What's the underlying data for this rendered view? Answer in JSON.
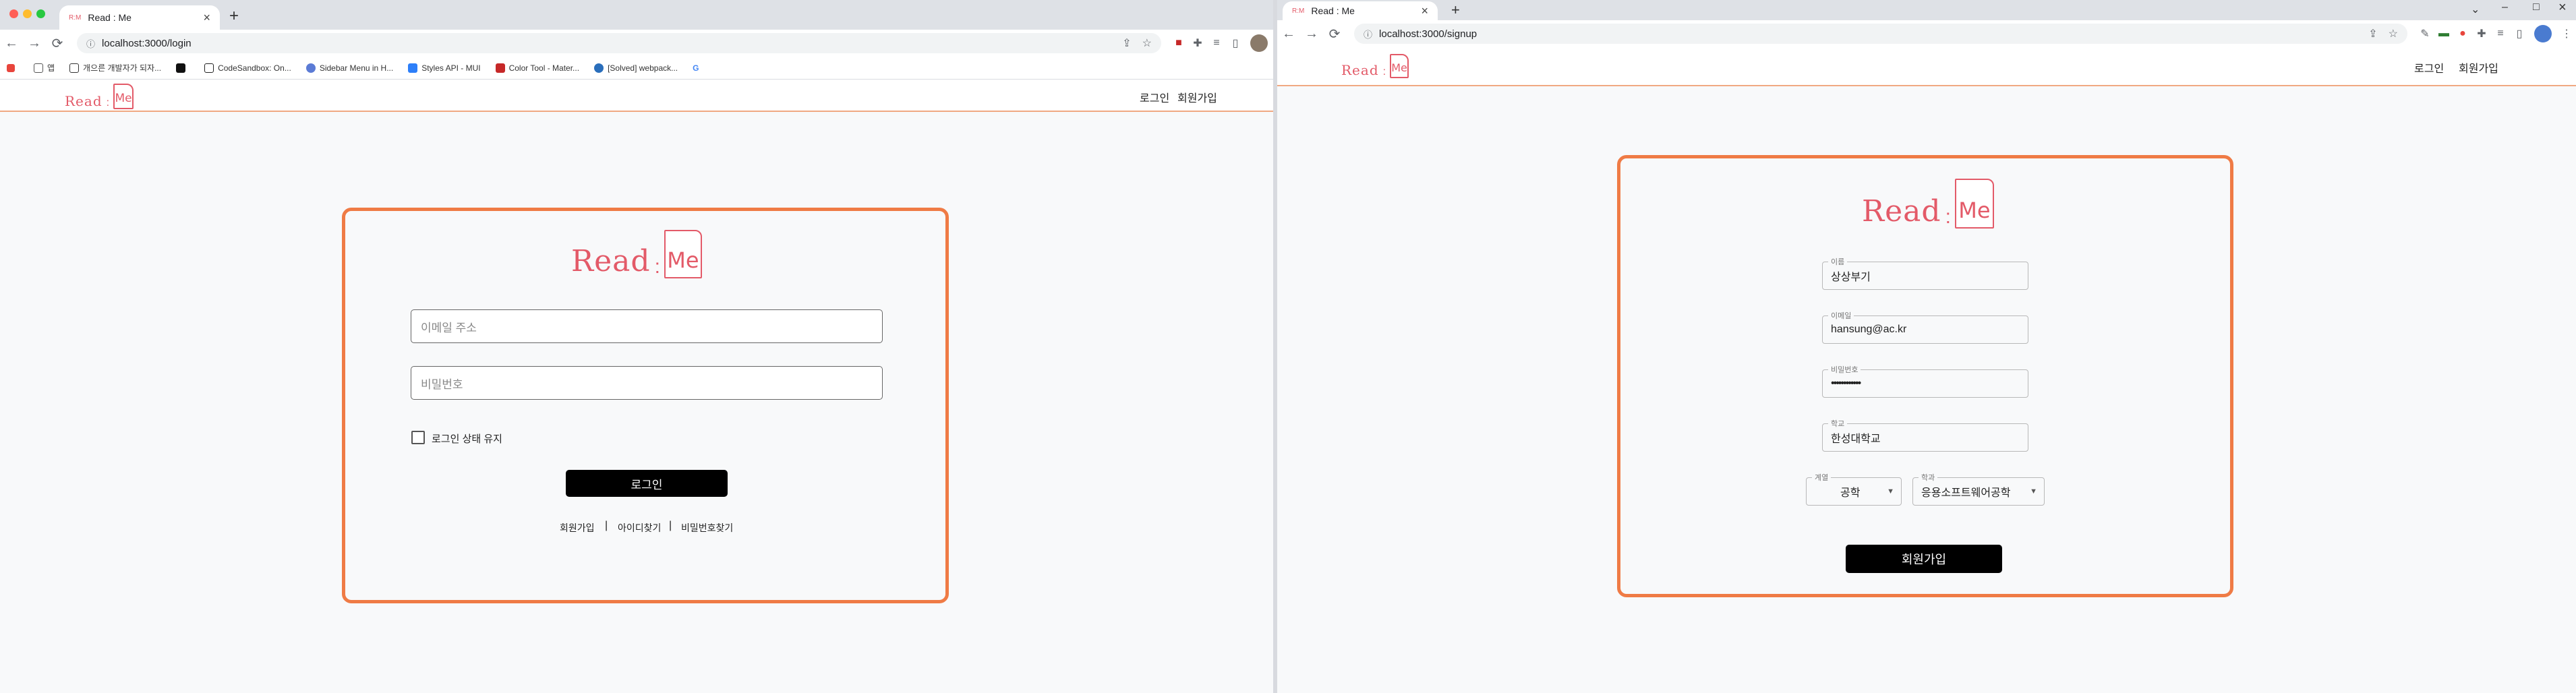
{
  "left_window": {
    "tab": {
      "title": "Read : Me",
      "close": "×"
    },
    "new_tab": "+",
    "nav": {
      "back": "←",
      "forward": "→",
      "reload": "⟳"
    },
    "url": "localhost:3000/login",
    "bookmarks": [
      {
        "label": "",
        "icon_color": "#e8453c"
      },
      {
        "label": "앱",
        "icon_color": "#555555"
      },
      {
        "label": "개으른 개발자가 되자...",
        "icon_color": "#333333"
      },
      {
        "label": "",
        "icon_color": "#111111"
      },
      {
        "label": "CodeSandbox: On...",
        "icon_color": "#222222"
      },
      {
        "label": "Sidebar Menu in H...",
        "icon_color": "#5b7bd5"
      },
      {
        "label": "Styles API - MUI",
        "icon_color": "#2d7ff9"
      },
      {
        "label": "Color Tool - Mater...",
        "icon_color": "#c62828"
      },
      {
        "label": "[Solved] webpack...",
        "icon_color": "#2a6ebb"
      },
      {
        "label": "G",
        "icon_color": "#ffffff"
      }
    ],
    "header": {
      "login": "로그인",
      "signup": "회원가입"
    },
    "form": {
      "email_placeholder": "이메일 주소",
      "password_placeholder": "비밀번호",
      "remember_label": "로그인 상태 유지",
      "submit": "로그인",
      "links": [
        "회원가입",
        "아이디찾기",
        "비밀번호찾기"
      ],
      "sep": "|"
    }
  },
  "right_window": {
    "tab": {
      "title": "Read : Me",
      "close": "×"
    },
    "new_tab": "+",
    "nav": {
      "back": "←",
      "forward": "→",
      "reload": "⟳"
    },
    "url": "localhost:3000/signup",
    "window_controls": {
      "chevron": "⌄",
      "minimize": "–",
      "maximize": "□",
      "close": "×"
    },
    "header": {
      "login": "로그인",
      "signup": "회원가입"
    },
    "form": {
      "name": {
        "label": "이름",
        "value": "상상부기"
      },
      "email": {
        "label": "이메일",
        "value": "hansung@ac.kr"
      },
      "password": {
        "label": "비밀번호",
        "value": "••••••••••••"
      },
      "school": {
        "label": "학교",
        "value": "한성대학교"
      },
      "track": {
        "label": "계열",
        "value": "공학"
      },
      "major": {
        "label": "학과",
        "value": "응용소프트웨어공학"
      },
      "submit": "회원가입"
    }
  },
  "logo": {
    "read": "Read",
    "colon": ":",
    "me": "Me",
    "doc_caption": "READ:ME"
  },
  "colors": {
    "accent_orange": "#ef7b45",
    "logo_pink": "#e35a68",
    "button_black": "#000000",
    "page_bg": "#f8f9fa"
  }
}
